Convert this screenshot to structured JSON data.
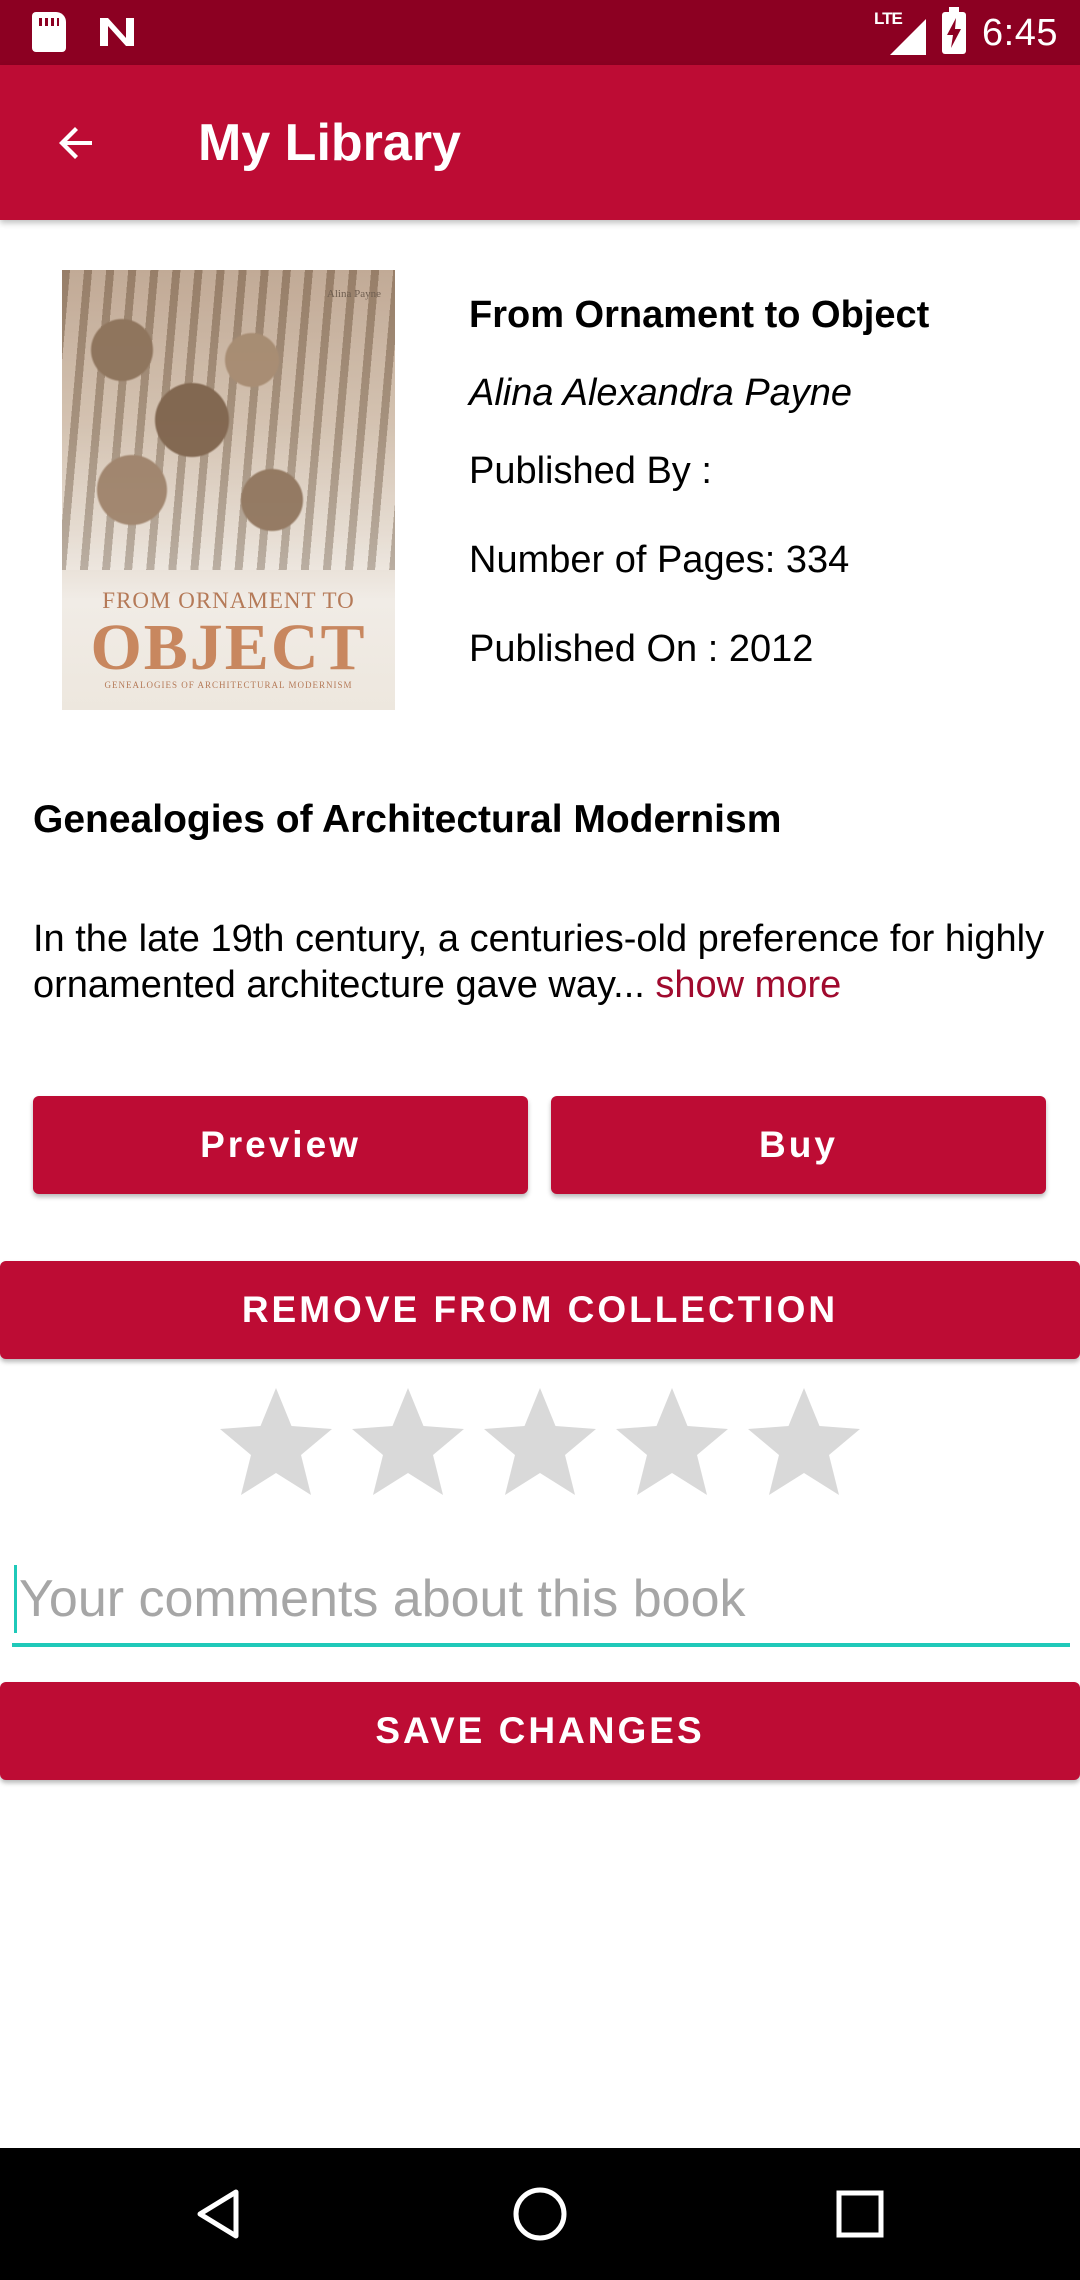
{
  "status_bar": {
    "time": "6:45",
    "network": "LTE",
    "icons": [
      "sd-card-icon",
      "n-notification-icon",
      "lte-signal-icon",
      "battery-charging-icon"
    ]
  },
  "app_bar": {
    "title": "My Library",
    "back_icon": "arrow-back-icon",
    "color": "#bd0c34"
  },
  "book": {
    "cover": {
      "author": "Alina Payne",
      "title_line1": "FROM ORNAMENT TO",
      "title_line2": "OBJECT",
      "subtitle": "GENEALOGIES OF ARCHITECTURAL MODERNISM"
    },
    "title": "From Ornament to Object",
    "author": "Alina Alexandra Payne",
    "published_by": "Published By :",
    "pages": "Number of Pages: 334",
    "published_on": "Published On : 2012",
    "subtitle": "Genealogies of Architectural Modernism",
    "description": "In the late 19th century, a centuries-old preference for highly ornamented architecture gave way... ",
    "show_more": "show more"
  },
  "actions": {
    "preview": "Preview",
    "buy": "Buy",
    "remove": "REMOVE FROM COLLECTION",
    "save": "SAVE CHANGES"
  },
  "rating": {
    "value": 0,
    "max": 5,
    "empty_color": "#d9d9d9"
  },
  "comment": {
    "placeholder": "Your comments about this book",
    "value": "",
    "accent": "#1fc9b9"
  },
  "nav_bar": {
    "icons": [
      "nav-back-icon",
      "nav-home-icon",
      "nav-recents-icon"
    ]
  }
}
